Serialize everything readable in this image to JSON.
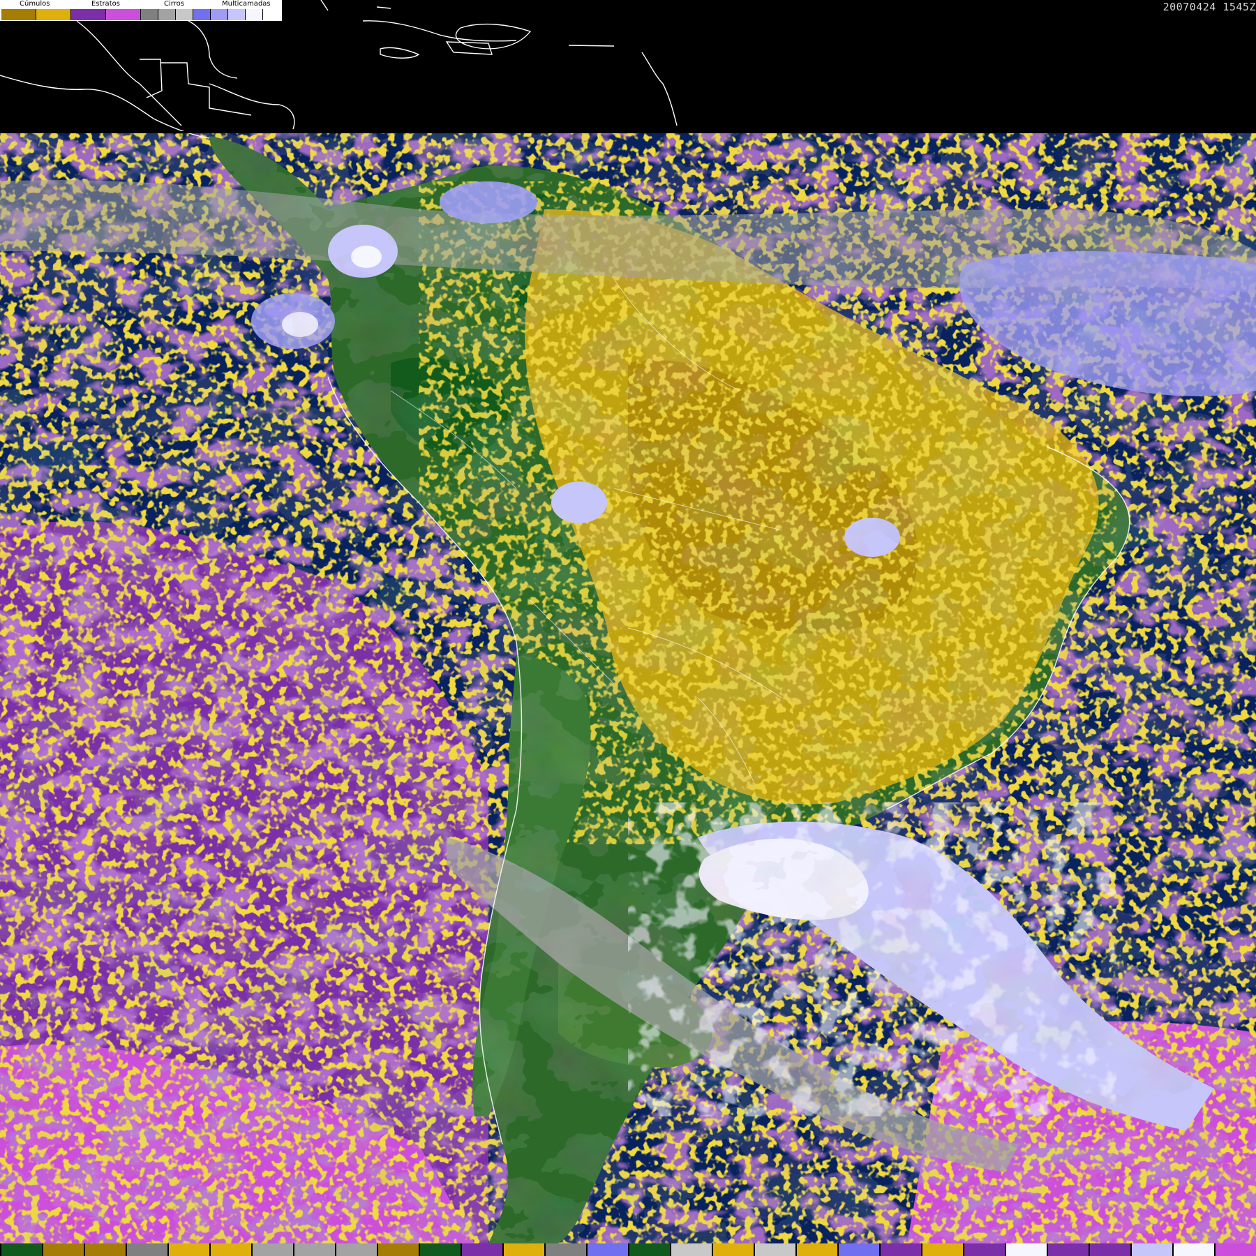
{
  "timestamp": "20070424 1545Z",
  "legend": {
    "categories": [
      {
        "label": "Cúmulos",
        "colors": [
          "#a57c06",
          "#dfb00c"
        ]
      },
      {
        "label": "Estratos",
        "colors": [
          "#7b2fa8",
          "#cc4fdc"
        ]
      },
      {
        "label": "Cirros",
        "colors": [
          "#808080",
          "#a3a3a3",
          "#c8c8c8"
        ]
      },
      {
        "label": "Multicamadas",
        "colors": [
          "#7070f0",
          "#9d9df6",
          "#c6c6fb",
          "#f6f6ff"
        ]
      }
    ]
  },
  "palette": {
    "ocean": "#07225e",
    "land": "#2d6a2a",
    "land_dark": "#0f5a1c",
    "cumulus_low": "#a57c06",
    "cumulus_high": "#dfb00c",
    "stratus_low": "#7b2fa8",
    "stratus_high": "#cc4fdc",
    "cirrus": "#a3a3a3",
    "multilayer": "#9d9df6",
    "multilayer_bright": "#e8e8ff",
    "coastline": "#ffffff"
  },
  "bottom_strip": [
    "#0f5a1c",
    "#a57c06",
    "#a57c06",
    "#808080",
    "#dfb00c",
    "#dfb00c",
    "#a3a3a3",
    "#a3a3a3",
    "#a3a3a3",
    "#a57c06",
    "#0f5a1c",
    "#7b2fa8",
    "#dfb00c",
    "#808080",
    "#7070f0",
    "#0f5a1c",
    "#c8c8c8",
    "#dfb00c",
    "#c8c8c8",
    "#dfb00c",
    "#7070f0",
    "#7b2fa8",
    "#dfb00c",
    "#7b2fa8",
    "#f6f6ff",
    "#7b2fa8",
    "#7b2fa8",
    "#c6c6fb",
    "#f6f6ff",
    "#cc4fdc"
  ]
}
